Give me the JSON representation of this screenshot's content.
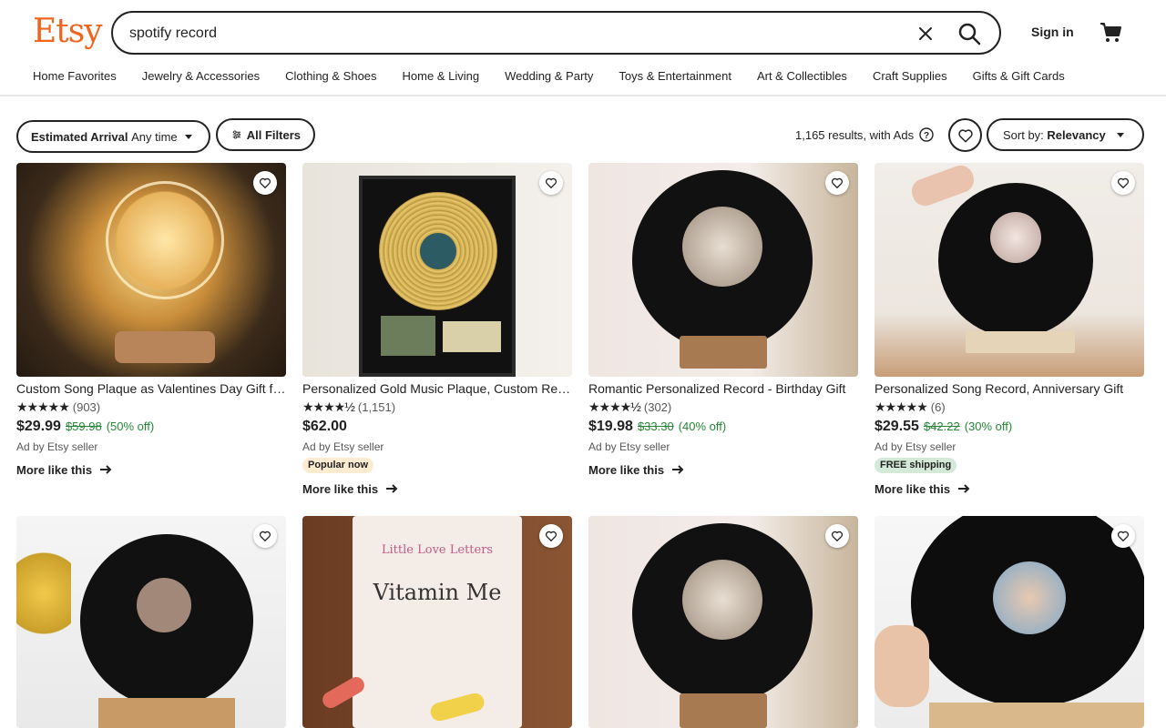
{
  "header": {
    "logo": "Etsy",
    "search_value": "spotify record",
    "sign_in": "Sign in"
  },
  "nav": [
    "Home Favorites",
    "Jewelry & Accessories",
    "Clothing & Shoes",
    "Home & Living",
    "Wedding & Party",
    "Toys & Entertainment",
    "Art & Collectibles",
    "Craft Supplies",
    "Gifts & Gift Cards"
  ],
  "filters": {
    "arrival_label": "Estimated Arrival",
    "arrival_value": "Any time",
    "all_filters": "All Filters",
    "results": "1,165 results, with Ads",
    "sort_label": "Sort by:",
    "sort_value": "Relevancy"
  },
  "colors": {
    "brand": "#f1641e",
    "sale_green": "#258635"
  },
  "listings": [
    {
      "title": "Custom Song Plaque as Valentines Day Gift for Her",
      "stars": "★★★★★",
      "reviews": "(903)",
      "price": "$29.99",
      "original": "$59.98",
      "discount": "(50% off)",
      "ad": "Ad by Etsy seller",
      "badge": "",
      "more": "More like this"
    },
    {
      "title": "Personalized Gold Music Plaque, Custom Record",
      "stars": "★★★★½",
      "reviews": "(1,151)",
      "price": "$62.00",
      "original": "",
      "discount": "",
      "ad": "Ad by Etsy seller",
      "badge": "Popular now",
      "more": "More like this"
    },
    {
      "title": "Romantic Personalized Record - Birthday Gift",
      "stars": "★★★★½",
      "reviews": "(302)",
      "price": "$19.98",
      "original": "$33.30",
      "discount": "(40% off)",
      "ad": "Ad by Etsy seller",
      "badge": "",
      "more": "More like this"
    },
    {
      "title": "Personalized Song Record, Anniversary Gift",
      "stars": "★★★★★",
      "reviews": "(6)",
      "price": "$29.55",
      "original": "$42.22",
      "discount": "(30% off)",
      "ad": "Ad by Etsy seller",
      "badge": "FREE shipping",
      "more": "More like this"
    }
  ],
  "row2": [
    {
      "image_text": ""
    },
    {
      "image_text": "Vitamin Me"
    },
    {
      "image_text": ""
    },
    {
      "image_text": ""
    }
  ],
  "image_labels": {
    "vitamin_top": "Little Love Letters",
    "vitamin_main": "Vitamin Me"
  }
}
